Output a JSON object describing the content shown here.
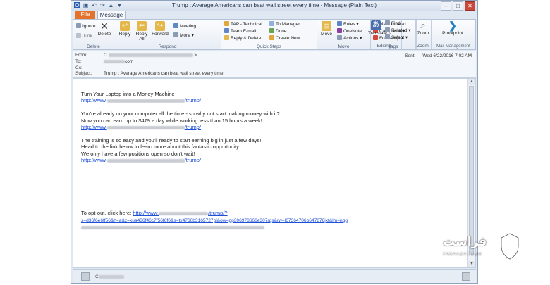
{
  "window": {
    "title": "Trump : Average Americans can beat wall street every time - Message (Plain Text)",
    "controls": [
      "–",
      "□",
      "✕"
    ]
  },
  "tabs": [
    {
      "label": "File"
    },
    {
      "label": "Message"
    }
  ],
  "ribbon": {
    "delete_group": {
      "label": "Delete",
      "ignore": "Ignore",
      "junk": "Junk",
      "delete": "Delete"
    },
    "respond_group": {
      "label": "Respond",
      "reply": "Reply",
      "reply_all": "Reply All",
      "forward": "Forward",
      "meeting": "Meeting",
      "more": "More"
    },
    "quick_steps_group": {
      "label": "Quick Steps",
      "items": [
        "TAP - Technical",
        "Team E-mail",
        "Reply & Delete",
        "To Manager",
        "Done",
        "Create New"
      ]
    },
    "move_group": {
      "label": "Move",
      "move": "Move",
      "rules": "Rules",
      "onenote": "OneNote",
      "actions": "Actions"
    },
    "tags_group": {
      "label": "Tags",
      "mark_unread": "Mark Unread",
      "categorize": "Categorize",
      "follow_up": "Follow Up"
    },
    "editing_group": {
      "label": "Editing",
      "translate": "Translate",
      "find": "Find",
      "related": "Related",
      "select": "Select"
    },
    "zoom_group": {
      "label": "Zoom",
      "zoom": "Zoom"
    },
    "mail_mgmt_group": {
      "label": "Mail Management",
      "proofpoint": "Proofpoint"
    }
  },
  "header": {
    "from_label": "From:",
    "from_value": "C",
    "to_label": "To:",
    "to_value": "com",
    "cc_label": "Cc:",
    "subject_label": "Subject:",
    "subject_value": "Trump : Average Americans can beat wall street every time",
    "sent_label": "Sent:",
    "sent_value": "Wed 6/22/2016 7:02 AM"
  },
  "body": {
    "line1": "Turn Your Laptop into a Money Machine",
    "link_prefix": "http://www.",
    "link_suffix": "/trump/",
    "para2_line1": "You're already on your computer all the time - so why not start making money with it?",
    "para2_line2": "Now you can earn up to $479 a day while working less than 15 hours a week!",
    "para3_line1": "The training is so easy and you'll ready to start earning big in just a few days!",
    "para3_line2": "Head to the link below to learn more about this fantastic opportunity.",
    "para3_line3": "We only have a few positions open so don't wait!",
    "optout_prefix": "To opt-out, click here: ",
    "optout_link_suffix": "/trump/?",
    "optout_link_line2": "s=d36f6e6ff56&h=a&z=xua436f46c7f56f6f6&s=tx4766b3165727pl&ow=pp306978666e307rqs&rw=l67364706b647876jxt&lm=nqg"
  },
  "footer": {
    "sender_name": "C"
  },
  "watermark": {
    "arabic": "فراست",
    "latin": "FARAASAT.COM"
  }
}
